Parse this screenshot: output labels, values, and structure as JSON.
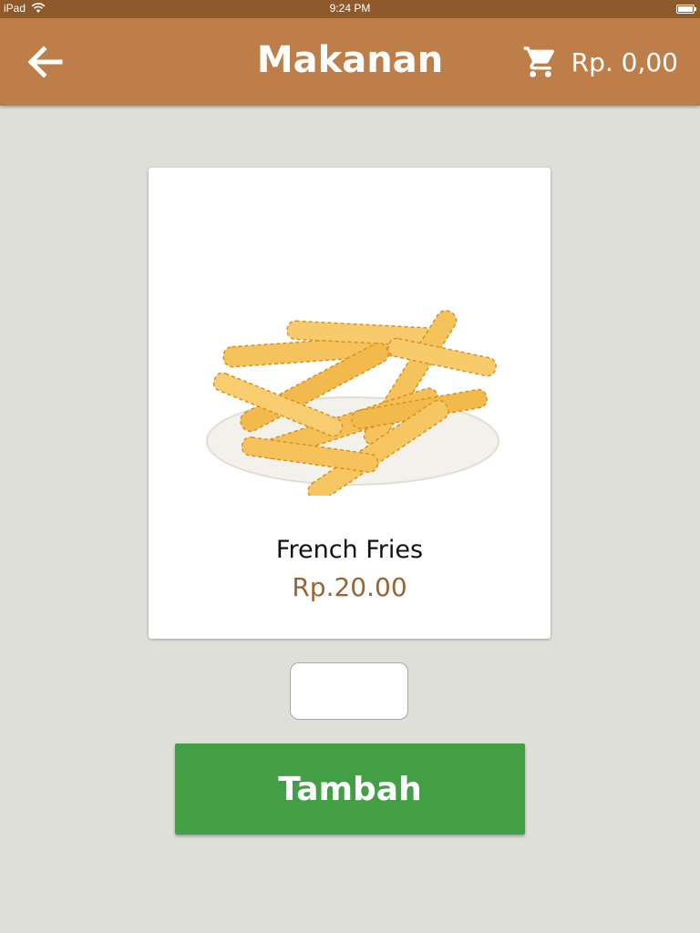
{
  "status_bar": {
    "device": "iPad",
    "time": "9:24 PM"
  },
  "header": {
    "title": "Makanan",
    "back_icon": "arrow-left-icon",
    "cart_icon": "shopping-cart-icon",
    "cart_total": "Rp. 0,00"
  },
  "product": {
    "name": "French Fries",
    "price": "Rp.20.00",
    "image": "french-fries-plate"
  },
  "quantity": {
    "value": ""
  },
  "actions": {
    "add_label": "Tambah"
  },
  "colors": {
    "status_bar": "#8f5a2b",
    "app_bar": "#bd7e4a",
    "background": "#dfdfda",
    "price": "#9a6434",
    "add_button": "#439f46"
  }
}
